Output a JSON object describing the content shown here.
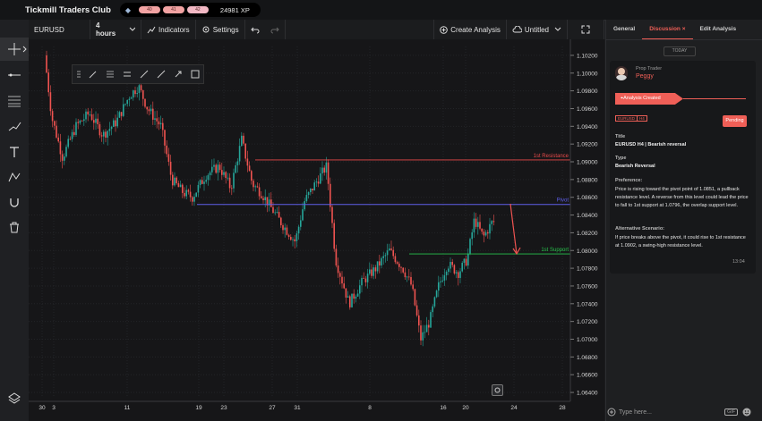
{
  "header": {
    "brand": "Tickmill Traders Club",
    "levels": [
      "40",
      "41",
      "42"
    ],
    "xp": "24981 XP"
  },
  "toolbar": {
    "symbol": "EURUSD",
    "interval": "4 hours",
    "indicators": "Indicators",
    "settings": "Settings",
    "create_analysis": "Create Analysis",
    "layout_name": "Untitled"
  },
  "chart": {
    "price_ticks": [
      "1.10200",
      "1.10000",
      "1.09800",
      "1.09600",
      "1.09400",
      "1.09200",
      "1.09000",
      "1.08800",
      "1.08600",
      "1.08400",
      "1.08200",
      "1.08000",
      "1.07800",
      "1.07600",
      "1.07400",
      "1.07200",
      "1.07000",
      "1.06800",
      "1.06600",
      "1.06400"
    ],
    "time_ticks": [
      "30",
      "3",
      "11",
      "19",
      "23",
      "27",
      "31",
      "8",
      "16",
      "20",
      "24",
      "28"
    ],
    "resistance": {
      "label": "1st Resistance",
      "price": 1.09021,
      "value_label": "1.09021"
    },
    "pivot": {
      "label": "Pivot",
      "price": 1.08519,
      "value_label": "1.08519"
    },
    "support": {
      "label": "1st Support",
      "price": 1.07962,
      "value_label": "1.07962"
    },
    "last_price": {
      "price": 1.08321,
      "value_label": "1.08321"
    },
    "y_min": 1.0635,
    "y_max": 1.103,
    "colors": {
      "up": "#26a69a",
      "down": "#ef5350",
      "resistance": "#e84a4a",
      "pivot": "#5e5ee8",
      "support": "#27c24c"
    }
  },
  "panel": {
    "tabs": [
      "General",
      "Discussion",
      "Edit Analysis"
    ],
    "today": "TODAY",
    "author_role": "Prop Trader",
    "author_name": "Peggy",
    "status_banner": "Analysis Created",
    "tags": [
      "EURUSD",
      "H4"
    ],
    "status": "Pending",
    "title_label": "Title",
    "title_value": "EURUSD H4 | Bearish reversal",
    "type_label": "Type",
    "type_value": "Bearish Reversal",
    "preference_label": "Preference:",
    "preference_text": "Price is rising toward the pivot point of 1.0851, a pullback resistance level. A reverse from this level could lead the price to fall to 1st support at 1.0796, the overlap support level.",
    "alt_label": "Alternative Scenario:",
    "alt_text": "If price breaks above the pivot, it could rise to 1st resistance at 1.0902, a swing-high resistance level.",
    "time": "13:04",
    "input_placeholder": "Type here...",
    "gif_label": "GIF"
  }
}
